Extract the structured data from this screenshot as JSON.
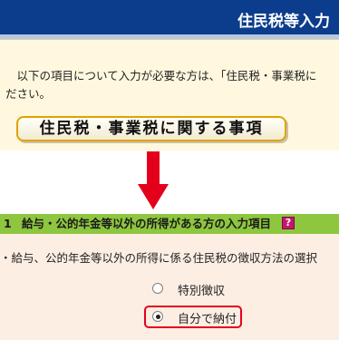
{
  "header": {
    "title": "住民税等入力"
  },
  "intro": {
    "text": "　以下の項目について入力が必要な方は、「住民税・事業税に\nださい。"
  },
  "section_button": {
    "label": "住民税・事業税に関する事項"
  },
  "section": {
    "number": "1",
    "title": "給与・公的年金等以外の所得がある方の入力項目",
    "help_icon_glyph": "?",
    "question": "・給与、公的年金等以外の所得に係る住民税の徴収方法の選択",
    "options": [
      {
        "label": "特別徴収",
        "selected": false
      },
      {
        "label": "自分で納付",
        "selected": true
      }
    ]
  },
  "colors": {
    "title_bar": "#0c3d8c",
    "section_header": "#8ec63f",
    "arrow": "#e4001b",
    "highlight": "#e4001b",
    "button_border": "#e0a200"
  }
}
